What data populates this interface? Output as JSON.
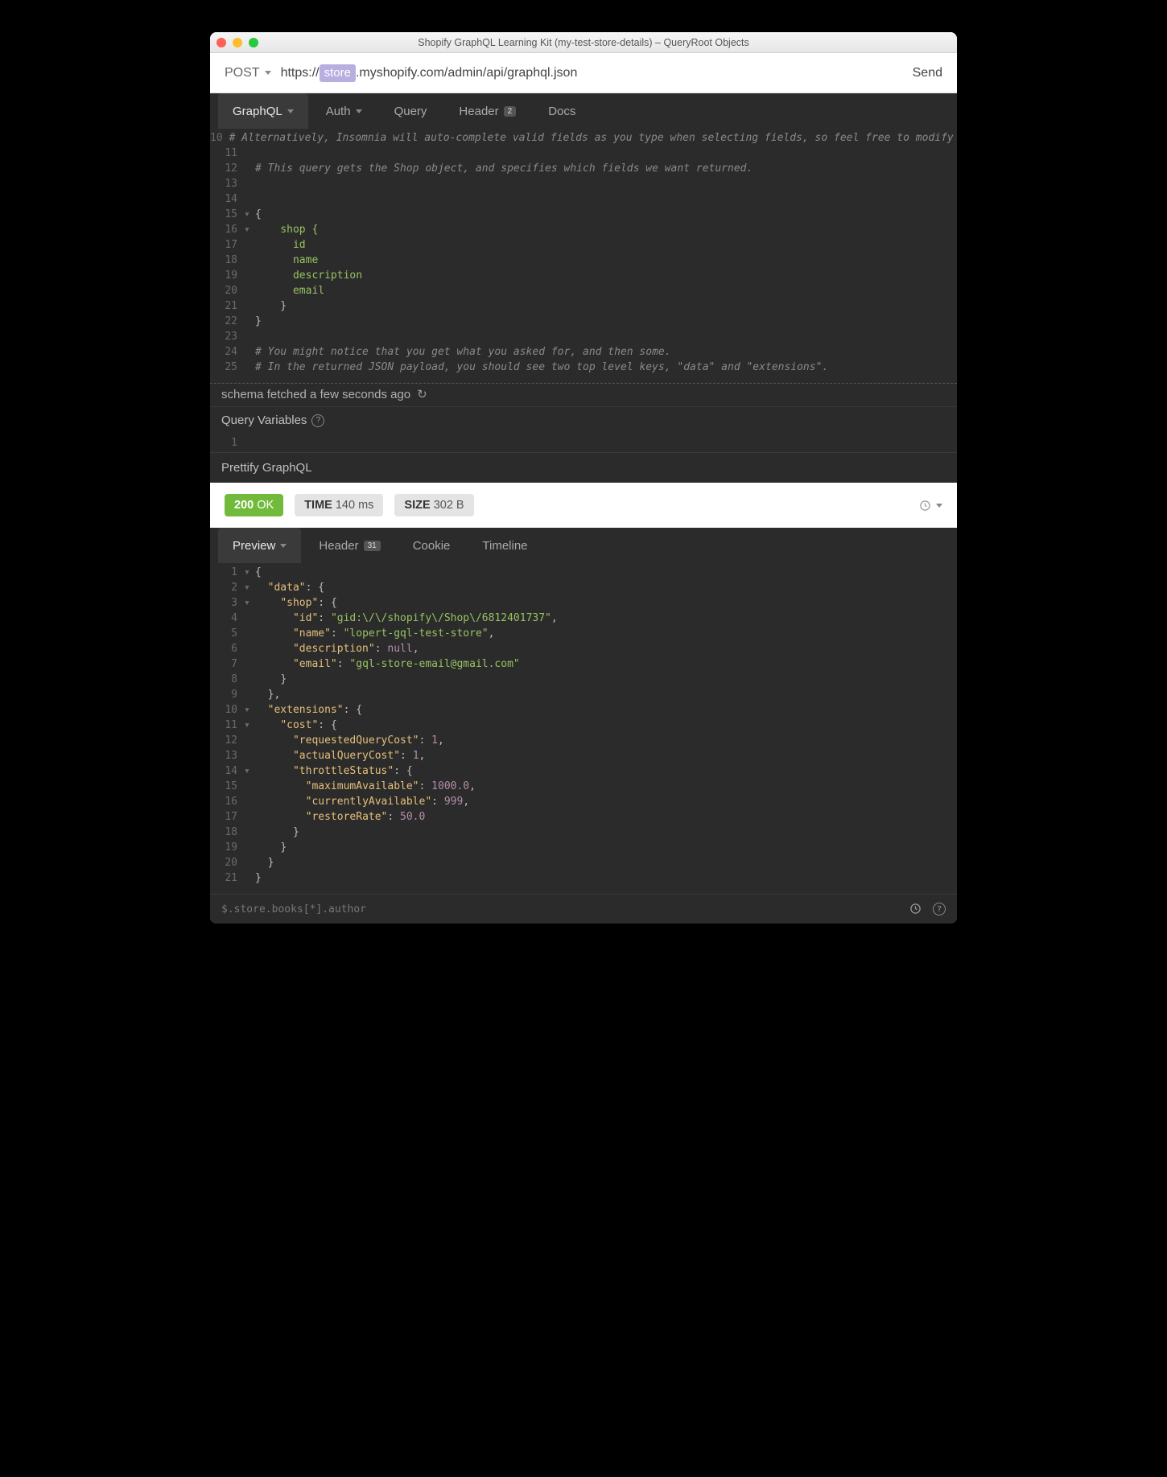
{
  "window": {
    "title": "Shopify GraphQL Learning Kit (my-test-store-details) – QueryRoot Objects"
  },
  "request": {
    "method": "POST",
    "url_prefix": "https://",
    "url_var": "store",
    "url_suffix": ".myshopify.com/admin/api/graphql.json",
    "send": "Send"
  },
  "reqTabs": {
    "graphql": "GraphQL",
    "auth": "Auth",
    "query": "Query",
    "header": "Header",
    "header_badge": "2",
    "docs": "Docs"
  },
  "queryLines": [
    {
      "n": "10",
      "fold": "",
      "cls": "cm-comment",
      "text": "# Alternatively, Insomnia will auto-complete valid fields as you type when selecting fields, so feel free to modify the query below to get more or less information back."
    },
    {
      "n": "11",
      "fold": "",
      "cls": "",
      "text": ""
    },
    {
      "n": "12",
      "fold": "",
      "cls": "cm-comment",
      "text": "# This query gets the Shop object, and specifies which fields we want returned."
    },
    {
      "n": "13",
      "fold": "",
      "cls": "",
      "text": ""
    },
    {
      "n": "14",
      "fold": "",
      "cls": "",
      "text": ""
    },
    {
      "n": "15",
      "fold": "▾",
      "cls": "cm-brace",
      "text": "{"
    },
    {
      "n": "16",
      "fold": "▾",
      "cls": "cm-kw",
      "text": "    shop {"
    },
    {
      "n": "17",
      "fold": "",
      "cls": "cm-prop",
      "text": "      id"
    },
    {
      "n": "18",
      "fold": "",
      "cls": "cm-prop",
      "text": "      name"
    },
    {
      "n": "19",
      "fold": "",
      "cls": "cm-prop",
      "text": "      description"
    },
    {
      "n": "20",
      "fold": "",
      "cls": "cm-prop",
      "text": "      email"
    },
    {
      "n": "21",
      "fold": "",
      "cls": "cm-brace",
      "text": "    }"
    },
    {
      "n": "22",
      "fold": "",
      "cls": "cm-brace",
      "text": "}"
    },
    {
      "n": "23",
      "fold": "",
      "cls": "",
      "text": ""
    },
    {
      "n": "24",
      "fold": "",
      "cls": "cm-comment",
      "text": "# You might notice that you get what you asked for, and then some."
    },
    {
      "n": "25",
      "fold": "",
      "cls": "cm-comment",
      "text": "# In the returned JSON payload, you should see two top level keys, \"data\" and \"extensions\"."
    }
  ],
  "schemaStatus": "schema fetched a few seconds ago",
  "queryVars": {
    "label": "Query Variables",
    "lines": [
      {
        "n": "1",
        "text": ""
      }
    ]
  },
  "prettify": "Prettify GraphQL",
  "response": {
    "status_code": "200",
    "status_text": "OK",
    "time_label": "TIME",
    "time_value": "140 ms",
    "size_label": "SIZE",
    "size_value": "302 B"
  },
  "respTabs": {
    "preview": "Preview",
    "header": "Header",
    "header_badge": "31",
    "cookie": "Cookie",
    "timeline": "Timeline"
  },
  "respLines": [
    {
      "n": "1",
      "fold": "▾",
      "tokens": [
        [
          "brace",
          "{"
        ]
      ]
    },
    {
      "n": "2",
      "fold": "▾",
      "tokens": [
        [
          "pad",
          "  "
        ],
        [
          "key",
          "\"data\""
        ],
        [
          "punc",
          ": "
        ],
        [
          "brace",
          "{"
        ]
      ]
    },
    {
      "n": "3",
      "fold": "▾",
      "tokens": [
        [
          "pad",
          "    "
        ],
        [
          "key",
          "\"shop\""
        ],
        [
          "punc",
          ": "
        ],
        [
          "brace",
          "{"
        ]
      ]
    },
    {
      "n": "4",
      "fold": "",
      "tokens": [
        [
          "pad",
          "      "
        ],
        [
          "key",
          "\"id\""
        ],
        [
          "punc",
          ": "
        ],
        [
          "str",
          "\"gid:\\/\\/shopify\\/Shop\\/6812401737\""
        ],
        [
          "punc",
          ","
        ]
      ]
    },
    {
      "n": "5",
      "fold": "",
      "tokens": [
        [
          "pad",
          "      "
        ],
        [
          "key",
          "\"name\""
        ],
        [
          "punc",
          ": "
        ],
        [
          "str",
          "\"lopert-gql-test-store\""
        ],
        [
          "punc",
          ","
        ]
      ]
    },
    {
      "n": "6",
      "fold": "",
      "tokens": [
        [
          "pad",
          "      "
        ],
        [
          "key",
          "\"description\""
        ],
        [
          "punc",
          ": "
        ],
        [
          "null",
          "null"
        ],
        [
          "punc",
          ","
        ]
      ]
    },
    {
      "n": "7",
      "fold": "",
      "tokens": [
        [
          "pad",
          "      "
        ],
        [
          "key",
          "\"email\""
        ],
        [
          "punc",
          ": "
        ],
        [
          "str",
          "\"gql-store-email@gmail.com\""
        ]
      ]
    },
    {
      "n": "8",
      "fold": "",
      "tokens": [
        [
          "pad",
          "    "
        ],
        [
          "brace",
          "}"
        ]
      ]
    },
    {
      "n": "9",
      "fold": "",
      "tokens": [
        [
          "pad",
          "  "
        ],
        [
          "brace",
          "}"
        ],
        [
          "punc",
          ","
        ]
      ]
    },
    {
      "n": "10",
      "fold": "▾",
      "tokens": [
        [
          "pad",
          "  "
        ],
        [
          "key",
          "\"extensions\""
        ],
        [
          "punc",
          ": "
        ],
        [
          "brace",
          "{"
        ]
      ]
    },
    {
      "n": "11",
      "fold": "▾",
      "tokens": [
        [
          "pad",
          "    "
        ],
        [
          "key",
          "\"cost\""
        ],
        [
          "punc",
          ": "
        ],
        [
          "brace",
          "{"
        ]
      ]
    },
    {
      "n": "12",
      "fold": "",
      "tokens": [
        [
          "pad",
          "      "
        ],
        [
          "key",
          "\"requestedQueryCost\""
        ],
        [
          "punc",
          ": "
        ],
        [
          "num",
          "1"
        ],
        [
          "punc",
          ","
        ]
      ]
    },
    {
      "n": "13",
      "fold": "",
      "tokens": [
        [
          "pad",
          "      "
        ],
        [
          "key",
          "\"actualQueryCost\""
        ],
        [
          "punc",
          ": "
        ],
        [
          "num",
          "1"
        ],
        [
          "punc",
          ","
        ]
      ]
    },
    {
      "n": "14",
      "fold": "▾",
      "tokens": [
        [
          "pad",
          "      "
        ],
        [
          "key",
          "\"throttleStatus\""
        ],
        [
          "punc",
          ": "
        ],
        [
          "brace",
          "{"
        ]
      ]
    },
    {
      "n": "15",
      "fold": "",
      "tokens": [
        [
          "pad",
          "        "
        ],
        [
          "key",
          "\"maximumAvailable\""
        ],
        [
          "punc",
          ": "
        ],
        [
          "num",
          "1000.0"
        ],
        [
          "punc",
          ","
        ]
      ]
    },
    {
      "n": "16",
      "fold": "",
      "tokens": [
        [
          "pad",
          "        "
        ],
        [
          "key",
          "\"currentlyAvailable\""
        ],
        [
          "punc",
          ": "
        ],
        [
          "num",
          "999"
        ],
        [
          "punc",
          ","
        ]
      ]
    },
    {
      "n": "17",
      "fold": "",
      "tokens": [
        [
          "pad",
          "        "
        ],
        [
          "key",
          "\"restoreRate\""
        ],
        [
          "punc",
          ": "
        ],
        [
          "num",
          "50.0"
        ]
      ]
    },
    {
      "n": "18",
      "fold": "",
      "tokens": [
        [
          "pad",
          "      "
        ],
        [
          "brace",
          "}"
        ]
      ]
    },
    {
      "n": "19",
      "fold": "",
      "tokens": [
        [
          "pad",
          "    "
        ],
        [
          "brace",
          "}"
        ]
      ]
    },
    {
      "n": "20",
      "fold": "",
      "tokens": [
        [
          "pad",
          "  "
        ],
        [
          "brace",
          "}"
        ]
      ]
    },
    {
      "n": "21",
      "fold": "",
      "tokens": [
        [
          "brace",
          "}"
        ]
      ]
    }
  ],
  "footer": {
    "filter": "$.store.books[*].author"
  }
}
